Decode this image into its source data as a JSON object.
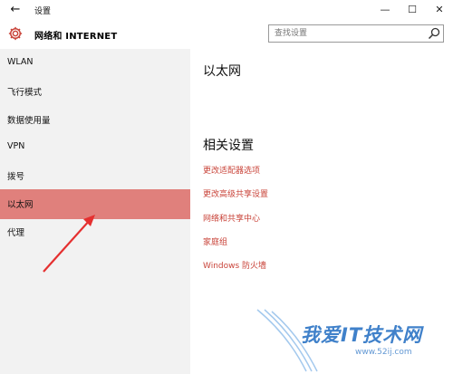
{
  "window": {
    "title": "设置",
    "back_glyph": "←",
    "min_glyph": "—",
    "max_glyph": "☐",
    "close_glyph": "✕"
  },
  "header": {
    "section_title": "网络和 INTERNET",
    "search_placeholder": "查找设置"
  },
  "sidebar": {
    "items": [
      {
        "label": "WLAN"
      },
      {
        "label": "飞行模式"
      },
      {
        "label": "数据使用量"
      },
      {
        "label": "VPN"
      },
      {
        "label": "拨号"
      },
      {
        "label": "以太网",
        "selected": true
      },
      {
        "label": "代理"
      }
    ]
  },
  "main": {
    "title": "以太网",
    "related_heading": "相关设置",
    "links": [
      {
        "label": "更改适配器选项"
      },
      {
        "label": "更改高级共享设置"
      },
      {
        "label": "网络和共享中心"
      },
      {
        "label": "家庭组"
      },
      {
        "label": "Windows 防火墙"
      }
    ]
  },
  "watermark": {
    "text": "我爱IT技术网",
    "url": "www.52ij.com"
  },
  "colors": {
    "accent": "#c9443a",
    "selected_bg": "#e0807c",
    "sidebar_bg": "#f2f2f2",
    "annotation_arrow": "#e53030"
  },
  "icons": {
    "gear": "gear-icon",
    "search": "search-icon",
    "back": "back-arrow-icon"
  }
}
